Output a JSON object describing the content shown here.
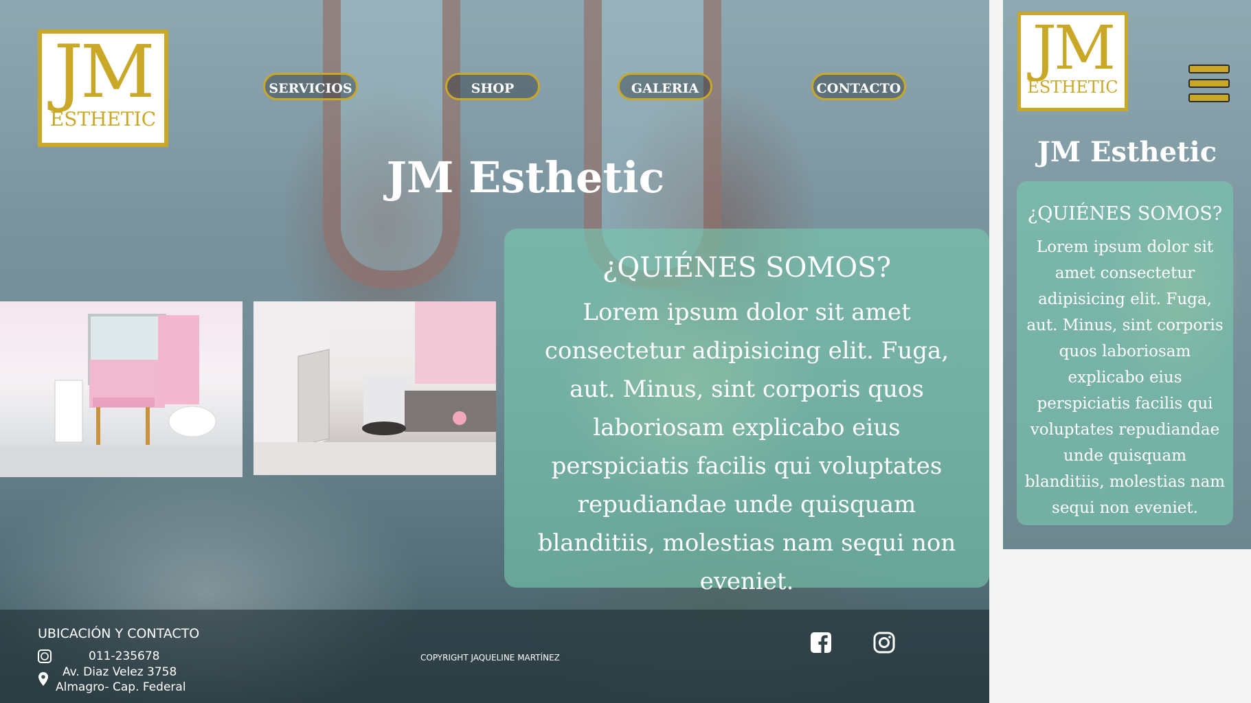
{
  "brand": {
    "logo_initials": "JM",
    "logo_word": "ESTHETIC",
    "site_title": "JM Esthetic",
    "gold_color": "#c8a826"
  },
  "nav": {
    "items": [
      "SERVICIOS",
      "SHOP",
      "GALERIA",
      "CONTACTO"
    ]
  },
  "about": {
    "heading": "¿QUIÉNES SOMOS?",
    "text": "Lorem ipsum dolor sit amet consectetur adipisicing elit. Fuga, aut. Minus, sint corporis quos laboriosam explicabo eius perspiciatis facilis qui voluptates repudiandae unde quisquam blanditiis, molestias nam sequi non eveniet."
  },
  "footer": {
    "heading": "UBICACIÓN Y CONTACTO",
    "phone": "011-235678",
    "address_line1": "Av. Diaz Velez 3758",
    "address_line2": "Almagro- Cap. Federal",
    "copyright": "COPYRIGHT JAQUELINE MARTÍNEZ",
    "icons": [
      "whatsapp-icon",
      "location-pin-icon",
      "facebook-icon",
      "instagram-icon"
    ]
  },
  "mobile": {
    "menu_icon": "hamburger-menu-icon"
  }
}
